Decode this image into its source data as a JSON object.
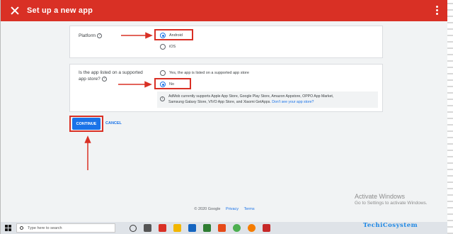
{
  "header": {
    "title": "Set up a new app"
  },
  "platform": {
    "label": "Platform",
    "options": [
      "Android",
      "iOS"
    ],
    "selected": "Android"
  },
  "store": {
    "label_line1": "Is the app listed on a supported",
    "label_line2": "app store?",
    "options": [
      "Yes, the app is listed on a supported app store",
      "No"
    ],
    "selected": "No",
    "info_text_1": "AdMob currently supports Apple App Store, Google Play Store, Amazon Appstore, OPPO App Market,",
    "info_text_2": "Samsung Galaxy Store, VIVO App Store, and Xiaomi GetApps.",
    "info_link": "Don't see your app store?"
  },
  "actions": {
    "continue": "CONTINUE",
    "cancel": "CANCEL"
  },
  "footer": {
    "copyright": "© 2020 Google",
    "privacy": "Privacy",
    "terms": "Terms"
  },
  "watermark": {
    "line1": "Activate Windows",
    "line2": "Go to Settings to activate Windows."
  },
  "taskbar": {
    "search_placeholder": "Type here to search"
  },
  "brand": {
    "part1": "Techi",
    "part2": "Cosystem"
  },
  "colors": {
    "header": "#d93025",
    "accent": "#1a73e8",
    "annotation": "#d93025"
  }
}
